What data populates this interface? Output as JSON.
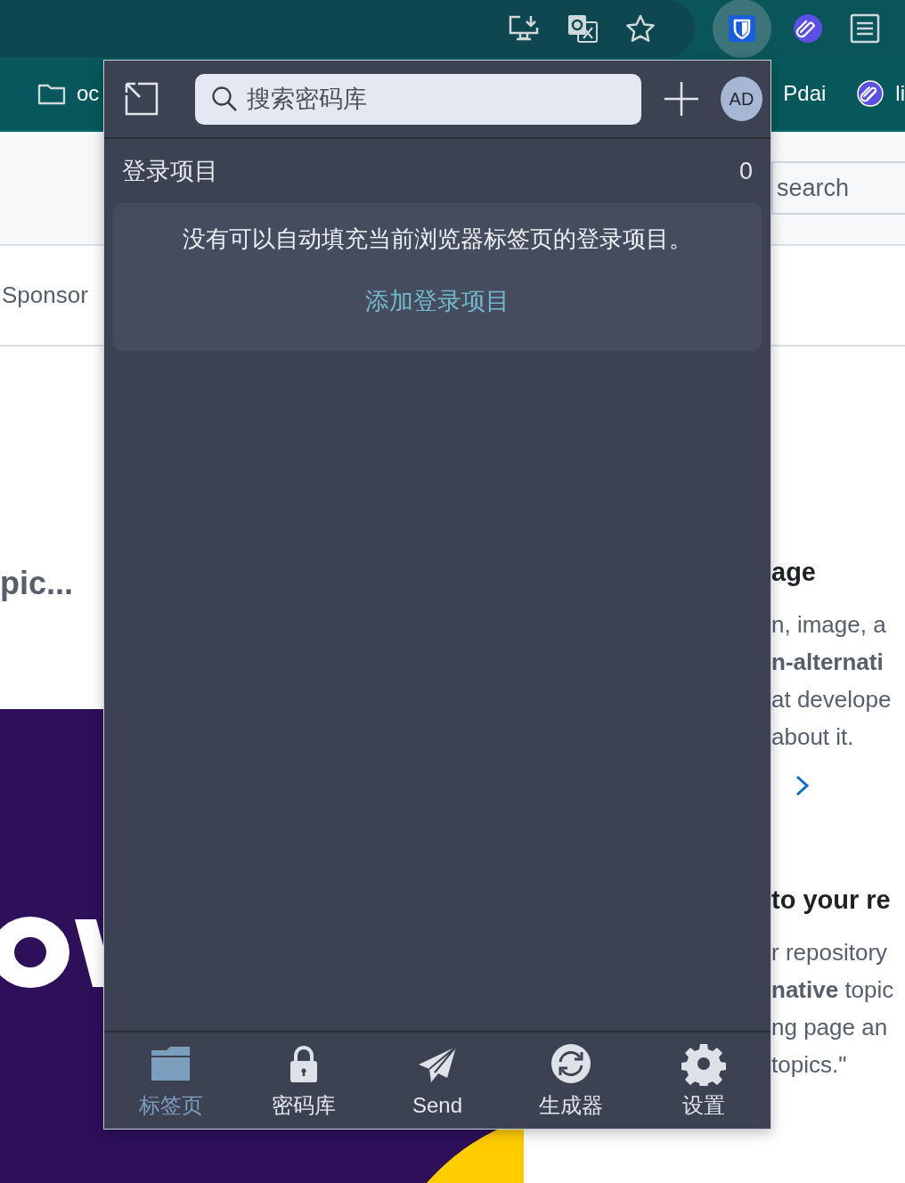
{
  "bookmarks": [
    {
      "kind": "folder",
      "label": "oc"
    },
    {
      "kind": "plain",
      "label": "Pdai"
    },
    {
      "kind": "site",
      "label": "li"
    }
  ],
  "page": {
    "search_placeholder": "search",
    "sponsors_label": "Sponsor",
    "left_heading": "pic...",
    "right_sections": [
      {
        "heading": "age",
        "lines": [
          "n, image, a",
          "**n-alternati**",
          "at develope",
          "about it."
        ],
        "more": true
      },
      {
        "heading": "to your re",
        "lines": [
          "r repository",
          "**native** topic",
          "ng page an",
          "topics.\""
        ],
        "more": false
      }
    ]
  },
  "popup": {
    "search_placeholder": "搜索密码库",
    "avatar": "AD",
    "section_title": "登录项目",
    "count": "0",
    "empty_message": "没有可以自动填充当前浏览器标签页的登录项目。",
    "add_link": "添加登录项目",
    "tabs": [
      {
        "kind": "tab",
        "label": "标签页",
        "selected": true
      },
      {
        "kind": "vault",
        "label": "密码库",
        "selected": false
      },
      {
        "kind": "send",
        "label": "Send",
        "selected": false
      },
      {
        "kind": "generator",
        "label": "生成器",
        "selected": false
      },
      {
        "kind": "settings",
        "label": "设置",
        "selected": false
      }
    ]
  }
}
